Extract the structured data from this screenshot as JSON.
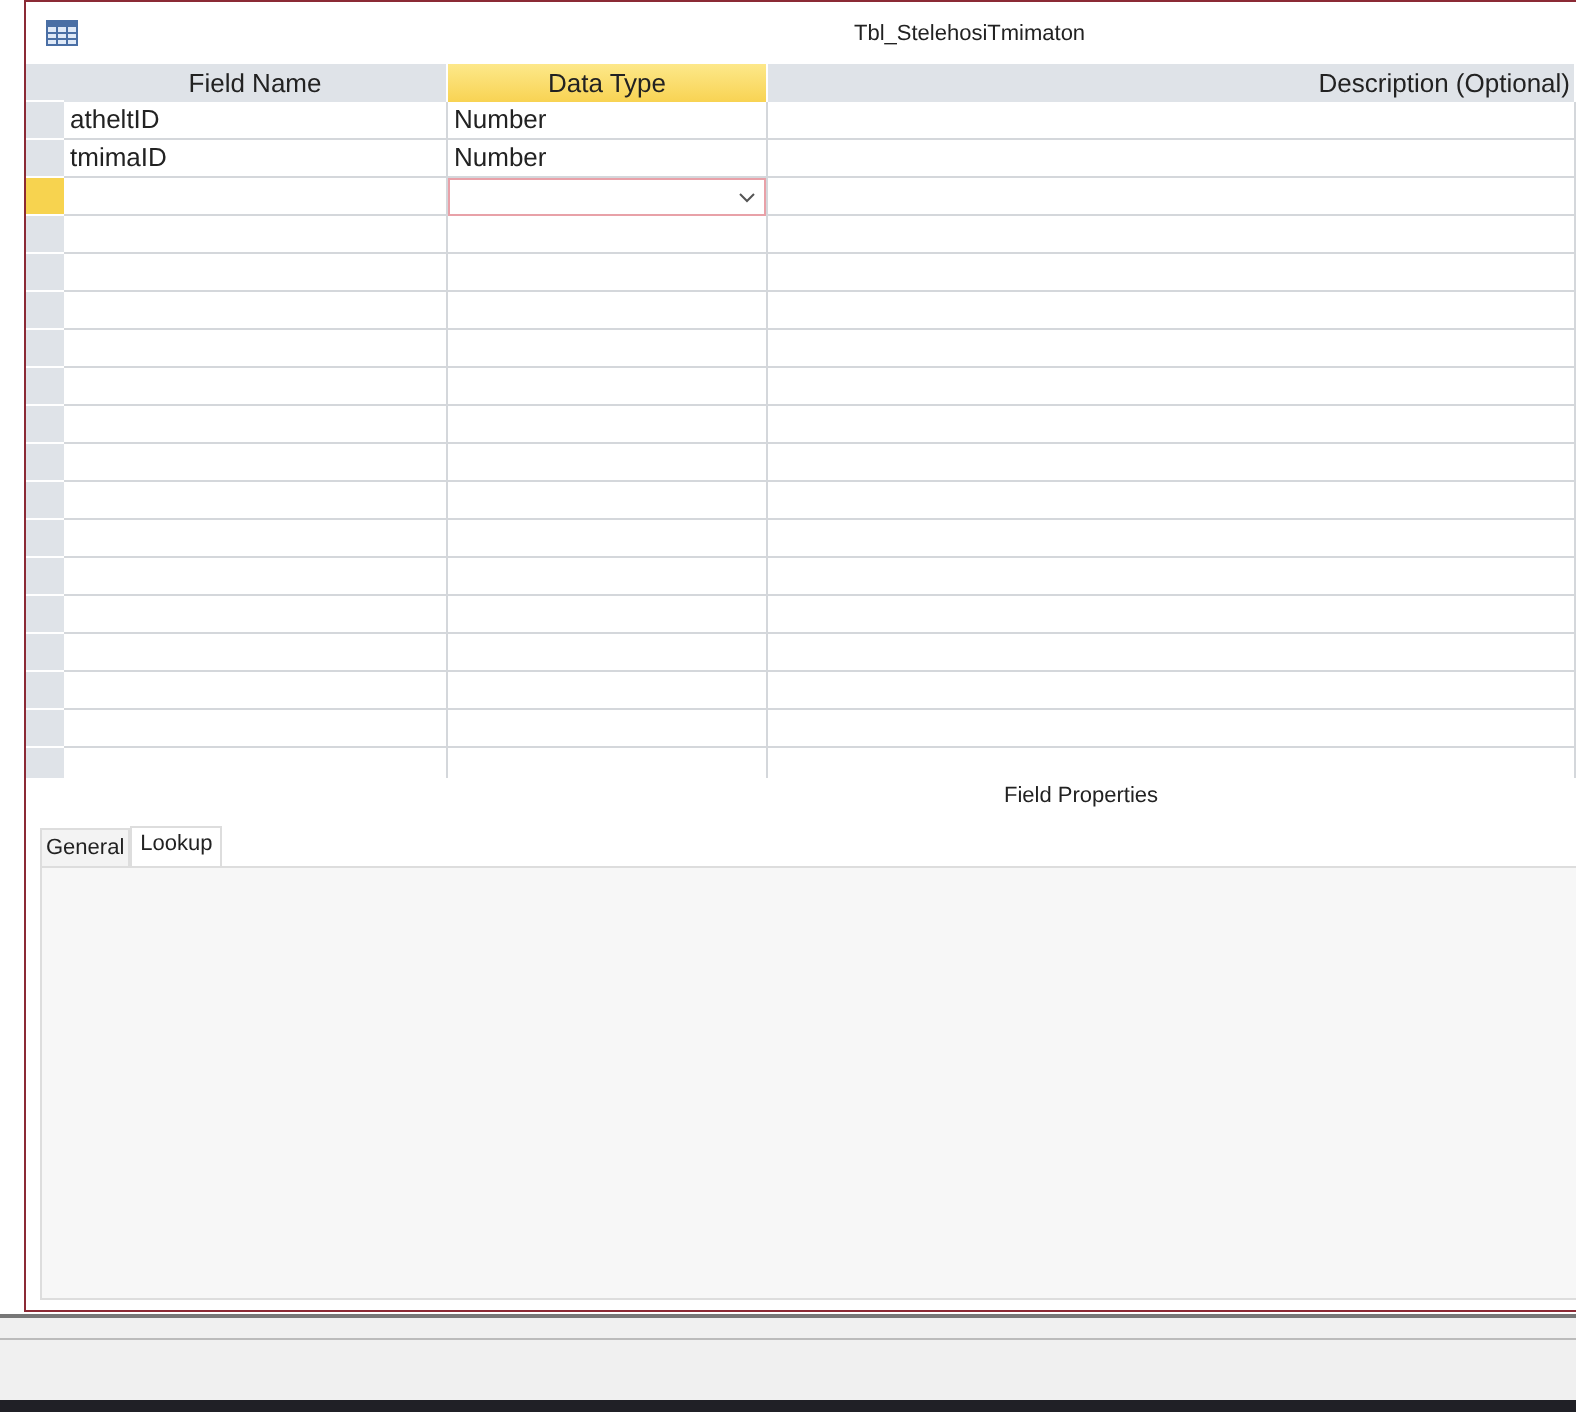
{
  "window": {
    "title": "Tbl_StelehosiTmimaton"
  },
  "table": {
    "columns": [
      {
        "label": "Field Name",
        "selected": false
      },
      {
        "label": "Data Type",
        "selected": true
      },
      {
        "label": "Description (Optional)",
        "selected": false
      }
    ],
    "rows": [
      {
        "field_name": "atheltID",
        "data_type": "Number",
        "selected": false
      },
      {
        "field_name": "tmimaID",
        "data_type": "Number",
        "selected": false
      },
      {
        "selected": true
      }
    ]
  },
  "field_properties": {
    "title": "Field Properties",
    "tabs": [
      {
        "label": "General",
        "selected": false
      },
      {
        "label": "Lookup",
        "selected": true
      }
    ]
  }
}
